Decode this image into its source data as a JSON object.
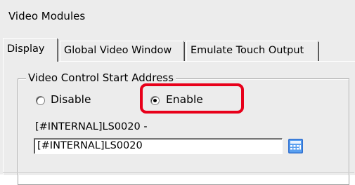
{
  "window": {
    "title": "Video Modules"
  },
  "tabs": [
    {
      "label": "Display",
      "active": true
    },
    {
      "label": "Global Video Window",
      "active": false
    },
    {
      "label": "Emulate Touch Output",
      "active": false
    }
  ],
  "video_control": {
    "group_label": "Video Control Start Address",
    "radio_disable_label": "Disable",
    "radio_enable_label": "Enable",
    "selected": "Enable",
    "address_range_text": "[#INTERNAL]LS0020 -",
    "address_value": "[#INTERNAL]LS0020"
  },
  "colors": {
    "panel_background": "#ececec",
    "highlight_border": "#e8001a",
    "picker_icon": "#3a7bd5"
  },
  "icons": {
    "address_picker": "keypad-icon"
  }
}
